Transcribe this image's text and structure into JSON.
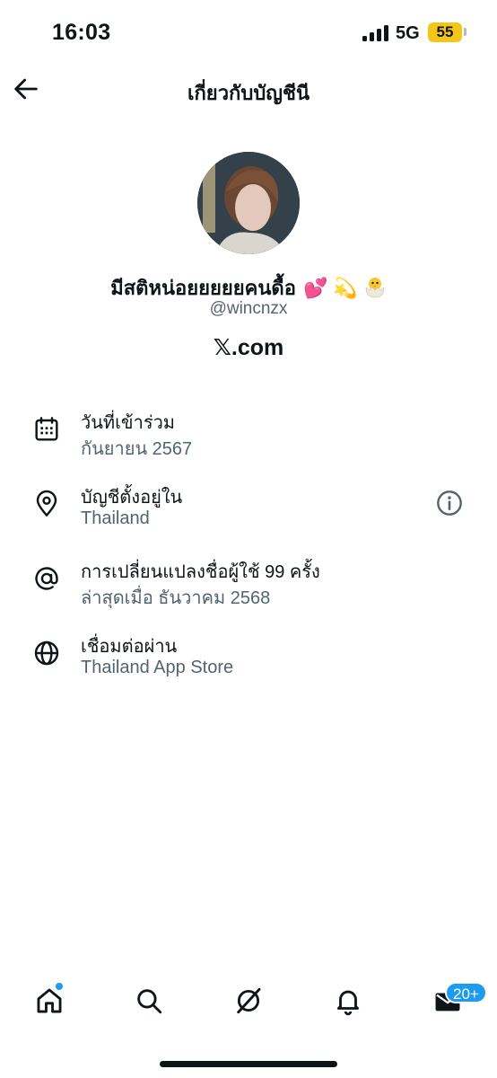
{
  "status_bar": {
    "time": "16:03",
    "network": "5G",
    "battery": "55"
  },
  "header": {
    "title": "เกี่ยวกับบัญชีนี",
    "back_icon": "arrow-left-icon"
  },
  "profile": {
    "display_name": "มีสติหน่อยยยยยคนดื้อ",
    "emojis": [
      "💕",
      "💫",
      "🐣"
    ],
    "handle": "@wincnzx",
    "site": "𝕏.com"
  },
  "info_rows": [
    {
      "icon": "calendar-icon",
      "title": "วันที่เข้าร่วม",
      "subtitle": "กันยายน 2567"
    },
    {
      "icon": "location-pin-icon",
      "title": "บัญชีตั้งอยู่ใน",
      "subtitle": "Thailand"
    },
    {
      "icon": "at-sign-icon",
      "title": "การเปลี่ยนแปลงชื่อผู้ใช้ 99 ครั้ง",
      "subtitle": "ล่าสุดเมื่อ ธันวาคม 2568"
    },
    {
      "icon": "globe-icon",
      "title": "เชื่อมต่อผ่าน",
      "subtitle": "Thailand App Store"
    }
  ],
  "tab_bar": {
    "items": [
      "home-icon",
      "search-icon",
      "grok-icon",
      "bell-icon",
      "mail-icon"
    ],
    "messages_badge": "20+"
  },
  "colors": {
    "accent": "#1d9bf0",
    "text": "#0f1419",
    "secondary": "#536471",
    "battery": "#f5c518"
  }
}
